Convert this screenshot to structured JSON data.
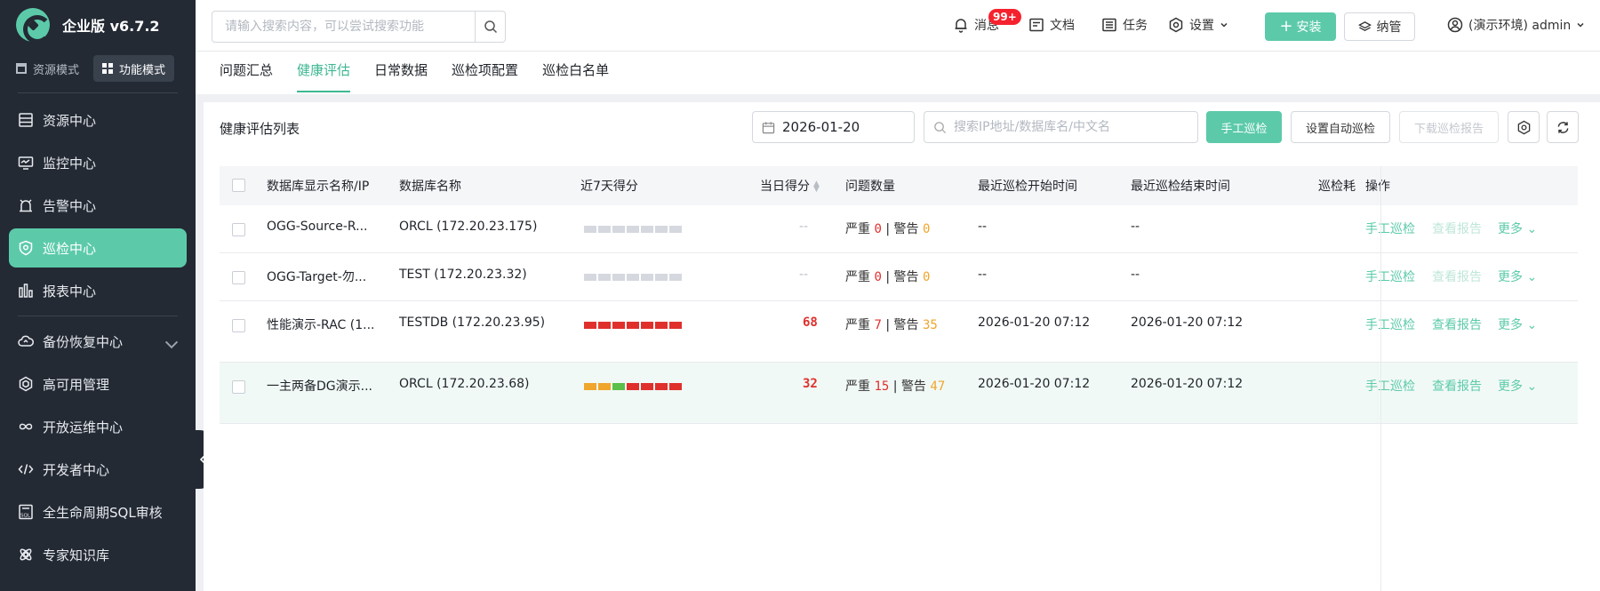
{
  "brand": {
    "title": "企业版 v6.7.2"
  },
  "mode": {
    "resource": "资源模式",
    "function": "功能模式"
  },
  "sidebar": {
    "items": [
      {
        "label": "资源中心",
        "icon": "server-icon"
      },
      {
        "label": "监控中心",
        "icon": "monitor-icon"
      },
      {
        "label": "告警中心",
        "icon": "alarm-icon"
      },
      {
        "label": "巡检中心",
        "icon": "shield-icon",
        "active": true
      },
      {
        "label": "报表中心",
        "icon": "bar-chart-icon"
      },
      {
        "label": "备份恢复中心",
        "icon": "cloud-icon",
        "expandable": true
      },
      {
        "label": "高可用管理",
        "icon": "hexagon-icon"
      },
      {
        "label": "开放运维中心",
        "icon": "infinity-icon"
      },
      {
        "label": "开发者中心",
        "icon": "code-icon"
      },
      {
        "label": "全生命周期SQL审核",
        "icon": "sql-icon"
      },
      {
        "label": "专家知识库",
        "icon": "knowledge-icon"
      }
    ]
  },
  "topbar": {
    "search_placeholder": "请输入搜索内容，可以尝试搜索功能",
    "messages": "消息",
    "messages_badge": "99+",
    "docs": "文档",
    "tasks": "任务",
    "settings": "设置",
    "install": "安装",
    "manage": "纳管",
    "user": "(演示环境) admin"
  },
  "tabs": [
    "问题汇总",
    "健康评估",
    "日常数据",
    "巡检项配置",
    "巡检白名单"
  ],
  "active_tab": 1,
  "panel": {
    "title": "健康评估列表",
    "date": "2026-01-20",
    "filter_placeholder": "搜索IP地址/数据库名/中文名",
    "btn_manual": "手工巡检",
    "btn_auto": "设置自动巡检",
    "btn_download": "下载巡检报告"
  },
  "table": {
    "headers": [
      "数据库显示名称/IP",
      "数据库名称",
      "近7天得分",
      "当日得分",
      "问题数量",
      "最近巡检开始时间",
      "最近巡检结束时间",
      "巡检耗",
      "操作"
    ],
    "severe_label": "严重",
    "warn_label": "警告",
    "ops": {
      "manual": "手工巡检",
      "report": "查看报告",
      "more": "更多"
    },
    "rows": [
      {
        "name": "OGG-Source-R...",
        "db": "ORCL (172.20.23.175)",
        "bars": [
          "#d5d9df",
          "#d5d9df",
          "#d5d9df",
          "#d5d9df",
          "#d5d9df",
          "#d5d9df",
          "#d5d9df"
        ],
        "score": "--",
        "severe": "0",
        "warn": "0",
        "start": "--",
        "end": "--",
        "report_enabled": false
      },
      {
        "name": "OGG-Target-勿...",
        "db": "TEST (172.20.23.32)",
        "bars": [
          "#d5d9df",
          "#d5d9df",
          "#d5d9df",
          "#d5d9df",
          "#d5d9df",
          "#d5d9df",
          "#d5d9df"
        ],
        "score": "--",
        "severe": "0",
        "warn": "0",
        "start": "--",
        "end": "--",
        "report_enabled": false
      },
      {
        "name": "性能演示-RAC (1...",
        "db": "TESTDB (172.20.23.95)",
        "bars": [
          "#e0302c",
          "#e0302c",
          "#e0302c",
          "#e0302c",
          "#e0302c",
          "#e0302c",
          "#e0302c"
        ],
        "score": "68",
        "severe": "7",
        "warn": "35",
        "start": "2026-01-20 07:12",
        "end": "2026-01-20 07:12",
        "report_enabled": true
      },
      {
        "name": "一主两备DG演示...",
        "db": "ORCL (172.20.23.68)",
        "bars": [
          "#f0a52c",
          "#f0a52c",
          "#5cc04a",
          "#e0302c",
          "#e0302c",
          "#e0302c",
          "#e0302c"
        ],
        "score": "32",
        "severe": "15",
        "warn": "47",
        "start": "2026-01-20 07:12",
        "end": "2026-01-20 07:12",
        "report_enabled": true
      }
    ]
  },
  "colors": {
    "accent": "#5ccaa9",
    "sidebar": "#232a34",
    "severe": "#e0302c",
    "warn": "#f0a52c"
  }
}
